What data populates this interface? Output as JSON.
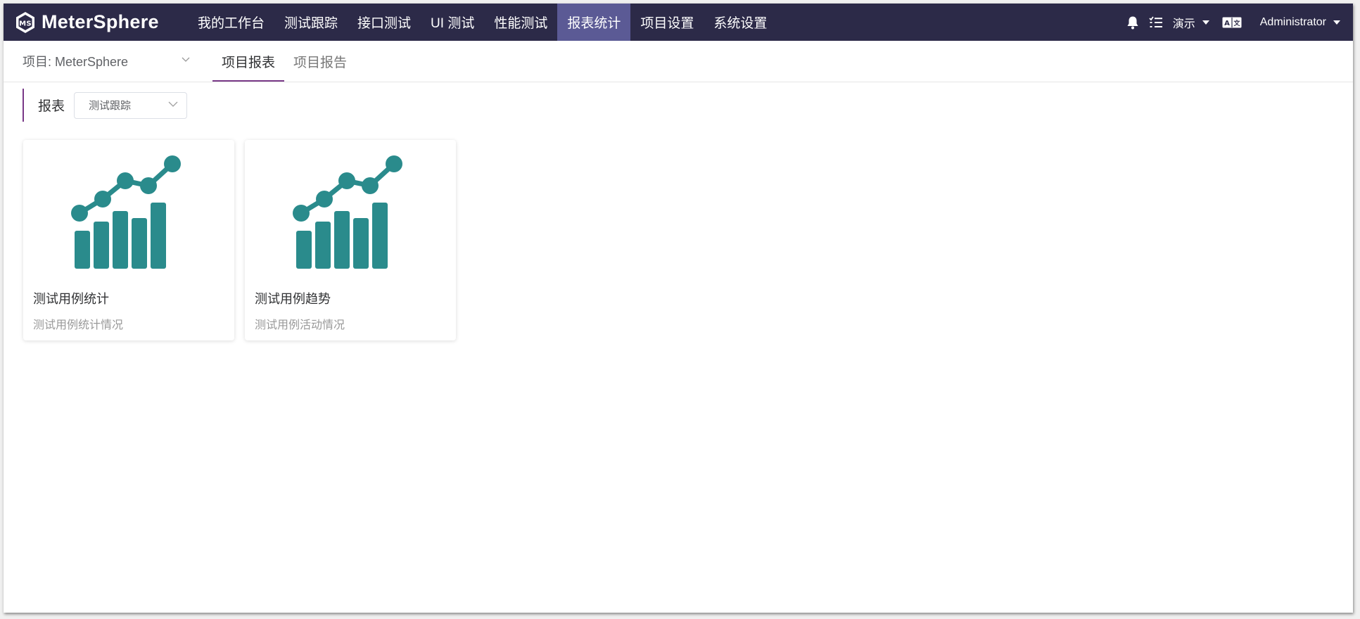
{
  "colors": {
    "topbar_bg": "#2c2a48",
    "nav_active_bg": "#5b5a95",
    "accent": "#783887",
    "chart_teal": "#2a8b8c"
  },
  "header": {
    "app_name": "MeterSphere",
    "nav": [
      {
        "label": "我的工作台",
        "active": false
      },
      {
        "label": "测试跟踪",
        "active": false
      },
      {
        "label": "接口测试",
        "active": false
      },
      {
        "label": "UI 测试",
        "active": false
      },
      {
        "label": "性能测试",
        "active": false
      },
      {
        "label": "报表统计",
        "active": true
      },
      {
        "label": "项目设置",
        "active": false
      },
      {
        "label": "系统设置",
        "active": false
      }
    ],
    "workspace": "演示",
    "user": "Administrator",
    "icons": [
      "bell-icon",
      "task-list-icon",
      "language-icon"
    ]
  },
  "subheader": {
    "project_label": "项目: MeterSphere",
    "tabs": [
      {
        "label": "项目报表",
        "active": true
      },
      {
        "label": "项目报告",
        "active": false
      }
    ]
  },
  "filter": {
    "label": "报表",
    "selected": "测试跟踪"
  },
  "cards": [
    {
      "title": "测试用例统计",
      "description": "测试用例统计情况",
      "icon": "chart-icon"
    },
    {
      "title": "测试用例趋势",
      "description": "测试用例活动情况",
      "icon": "chart-icon"
    }
  ]
}
